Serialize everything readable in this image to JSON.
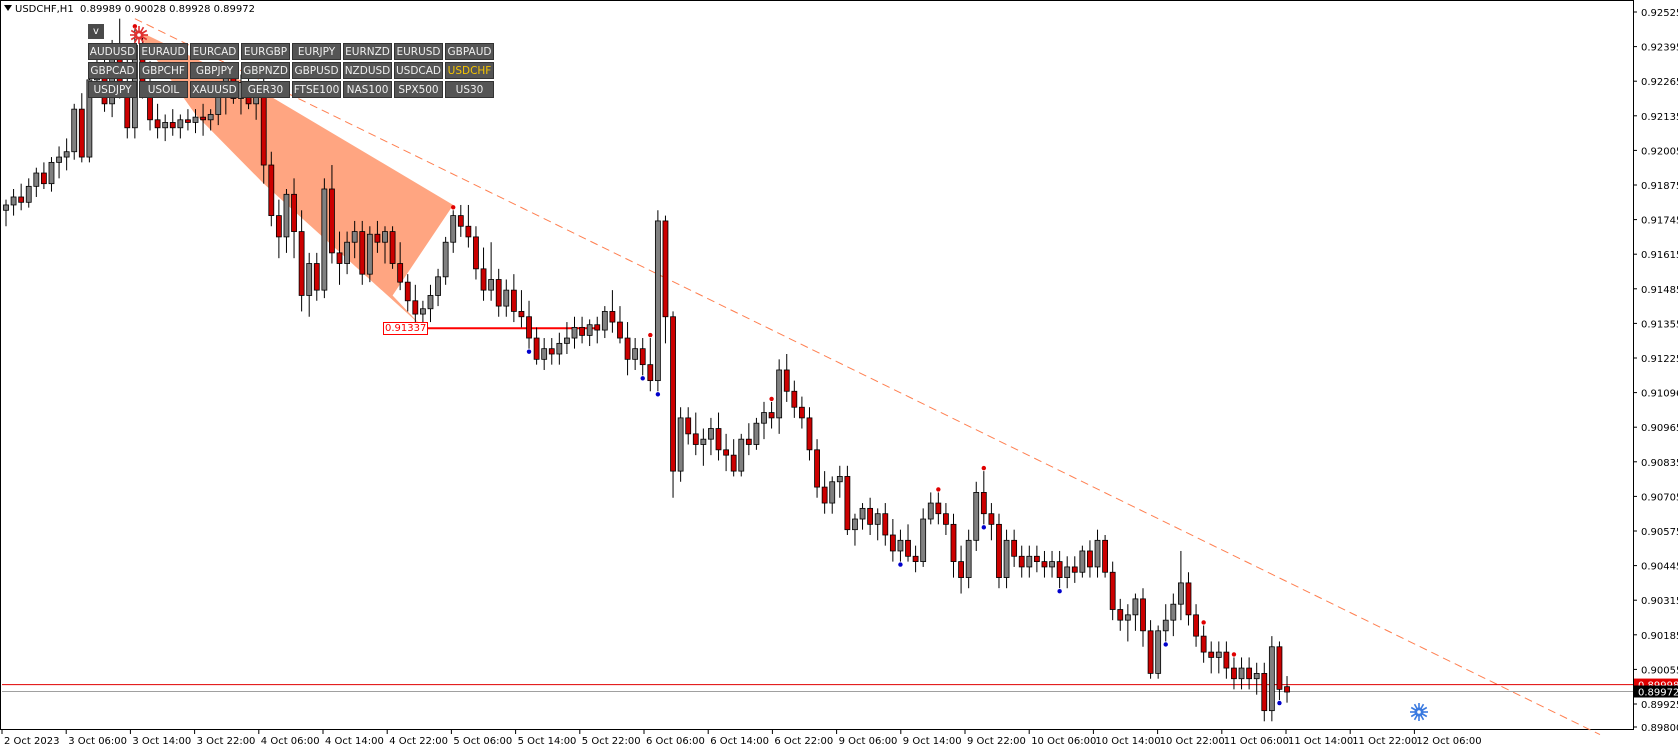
{
  "header": {
    "symbol_timeframe": "USDCHF,H1",
    "ohlc": "0.89989 0.90028 0.89928 0.89972"
  },
  "panel": {
    "toggle_label": "v",
    "active_symbol": "USDCHF",
    "symbols": [
      "AUDUSD",
      "EURAUD",
      "EURCAD",
      "EURGBP",
      "EURJPY",
      "EURNZD",
      "EURUSD",
      "GBPAUD",
      "GBPCAD",
      "GBPCHF",
      "GBPJPY",
      "GBPNZD",
      "GBPUSD",
      "NZDUSD",
      "USDCAD",
      "USDCHF",
      "USDJPY",
      "USOIL",
      "XAUUSD",
      "GER30",
      "FTSE100",
      "NAS100",
      "SPX500",
      "US30"
    ]
  },
  "colors": {
    "bull": "#808080",
    "bear": "#cc0000",
    "pattern_fill": "#ffa07a",
    "trendline": "#ff7f50",
    "swing_high_dot": "#e00000",
    "swing_low_dot": "#0000cc",
    "level_line": "#ff0000",
    "bid_line": "#a0a0a0"
  },
  "chart_data": {
    "type": "candlestick",
    "symbol": "USDCHF",
    "timeframe": "H1",
    "ylim": [
      0.898,
      0.9258
    ],
    "price_ticks": [
      "0.92525",
      "0.92395",
      "0.92265",
      "0.92135",
      "0.92005",
      "0.91875",
      "0.91745",
      "0.91615",
      "0.91485",
      "0.91355",
      "0.91225",
      "0.91096",
      "0.90965",
      "0.90835",
      "0.90705",
      "0.90575",
      "0.90445",
      "0.90315",
      "0.90185",
      "0.90055",
      "0.89925",
      "0.89800"
    ],
    "time_labels": [
      "2 Oct 2023",
      "3 Oct 06:00",
      "3 Oct 14:00",
      "3 Oct 22:00",
      "4 Oct 06:00",
      "4 Oct 14:00",
      "4 Oct 22:00",
      "5 Oct 06:00",
      "5 Oct 14:00",
      "5 Oct 22:00",
      "6 Oct 06:00",
      "6 Oct 14:00",
      "6 Oct 22:00",
      "9 Oct 06:00",
      "9 Oct 14:00",
      "9 Oct 22:00",
      "10 Oct 06:00",
      "10 Oct 14:00",
      "10 Oct 22:00",
      "11 Oct 06:00",
      "11 Oct 14:00",
      "11 Oct 22:00",
      "12 Oct 06:00"
    ],
    "level_label": "0.91337",
    "level_price": 0.91337,
    "bid_price": 0.89972,
    "bid_label": "0.89972",
    "red_line_price": 0.89998,
    "red_line_label": "0.89998",
    "candles": [
      [
        0.9178,
        0.9182,
        0.9172,
        0.918
      ],
      [
        0.918,
        0.9186,
        0.9176,
        0.9183
      ],
      [
        0.9183,
        0.9188,
        0.9178,
        0.9181
      ],
      [
        0.9181,
        0.919,
        0.9179,
        0.9187
      ],
      [
        0.9187,
        0.9194,
        0.9183,
        0.9192
      ],
      [
        0.9192,
        0.9196,
        0.9186,
        0.9188
      ],
      [
        0.9188,
        0.9198,
        0.9185,
        0.9196
      ],
      [
        0.9196,
        0.9202,
        0.919,
        0.9198
      ],
      [
        0.9198,
        0.9205,
        0.9193,
        0.92
      ],
      [
        0.92,
        0.9218,
        0.9197,
        0.9216
      ],
      [
        0.9216,
        0.9222,
        0.9196,
        0.9198
      ],
      [
        0.9198,
        0.923,
        0.9196,
        0.9227
      ],
      [
        0.9227,
        0.9236,
        0.9221,
        0.9233
      ],
      [
        0.9233,
        0.924,
        0.9215,
        0.9218
      ],
      [
        0.9218,
        0.9242,
        0.9213,
        0.9238
      ],
      [
        0.9238,
        0.925,
        0.922,
        0.9225
      ],
      [
        0.9225,
        0.9236,
        0.9205,
        0.9209
      ],
      [
        0.9209,
        0.9246,
        0.9205,
        0.924
      ],
      [
        0.924,
        0.9244,
        0.922,
        0.9224
      ],
      [
        0.9224,
        0.9234,
        0.9208,
        0.9212
      ],
      [
        0.9212,
        0.9218,
        0.9205,
        0.9209
      ],
      [
        0.9209,
        0.9214,
        0.9204,
        0.9211
      ],
      [
        0.9211,
        0.9216,
        0.9206,
        0.9209
      ],
      [
        0.9209,
        0.9214,
        0.9205,
        0.9212
      ],
      [
        0.9212,
        0.9216,
        0.9208,
        0.9211
      ],
      [
        0.9211,
        0.9216,
        0.9207,
        0.9213
      ],
      [
        0.9213,
        0.9218,
        0.9206,
        0.9212
      ],
      [
        0.9212,
        0.9216,
        0.9208,
        0.9214
      ],
      [
        0.9214,
        0.9226,
        0.921,
        0.9222
      ],
      [
        0.9222,
        0.923,
        0.9214,
        0.9228
      ],
      [
        0.9228,
        0.9232,
        0.9218,
        0.922
      ],
      [
        0.922,
        0.9229,
        0.9214,
        0.9226
      ],
      [
        0.9226,
        0.9228,
        0.9216,
        0.9218
      ],
      [
        0.9218,
        0.9226,
        0.9212,
        0.9224
      ],
      [
        0.9224,
        0.923,
        0.9188,
        0.9195
      ],
      [
        0.9195,
        0.92,
        0.9172,
        0.9176
      ],
      [
        0.9176,
        0.9182,
        0.916,
        0.9168
      ],
      [
        0.9168,
        0.9186,
        0.9162,
        0.9184
      ],
      [
        0.9184,
        0.919,
        0.916,
        0.917
      ],
      [
        0.917,
        0.9178,
        0.914,
        0.9146
      ],
      [
        0.9146,
        0.9162,
        0.9138,
        0.9158
      ],
      [
        0.9158,
        0.9162,
        0.9144,
        0.9148
      ],
      [
        0.9148,
        0.919,
        0.9145,
        0.9186
      ],
      [
        0.9186,
        0.9195,
        0.9158,
        0.9162
      ],
      [
        0.9162,
        0.917,
        0.915,
        0.9158
      ],
      [
        0.9158,
        0.917,
        0.9154,
        0.9166
      ],
      [
        0.9166,
        0.9174,
        0.916,
        0.917
      ],
      [
        0.917,
        0.9174,
        0.915,
        0.9154
      ],
      [
        0.9154,
        0.9172,
        0.9151,
        0.9169
      ],
      [
        0.9169,
        0.9174,
        0.9162,
        0.9166
      ],
      [
        0.9166,
        0.9172,
        0.9158,
        0.917
      ],
      [
        0.917,
        0.9172,
        0.9156,
        0.9158
      ],
      [
        0.9158,
        0.9166,
        0.9148,
        0.9151
      ],
      [
        0.9151,
        0.9154,
        0.914,
        0.9144
      ],
      [
        0.9144,
        0.915,
        0.9136,
        0.9139
      ],
      [
        0.9139,
        0.9144,
        0.9134,
        0.9141
      ],
      [
        0.9141,
        0.915,
        0.9136,
        0.9146
      ],
      [
        0.9146,
        0.9156,
        0.9142,
        0.9153
      ],
      [
        0.9153,
        0.9168,
        0.915,
        0.9166
      ],
      [
        0.9166,
        0.9178,
        0.9162,
        0.9176
      ],
      [
        0.9176,
        0.918,
        0.9168,
        0.9172
      ],
      [
        0.9172,
        0.918,
        0.9164,
        0.9168
      ],
      [
        0.9168,
        0.9172,
        0.9152,
        0.9156
      ],
      [
        0.9156,
        0.9164,
        0.9144,
        0.9148
      ],
      [
        0.9148,
        0.9166,
        0.9144,
        0.9152
      ],
      [
        0.9152,
        0.9156,
        0.9138,
        0.9142
      ],
      [
        0.9142,
        0.9152,
        0.9138,
        0.9148
      ],
      [
        0.9148,
        0.9154,
        0.9136,
        0.914
      ],
      [
        0.914,
        0.9148,
        0.9134,
        0.9138
      ],
      [
        0.9138,
        0.9144,
        0.9126,
        0.913
      ],
      [
        0.913,
        0.9134,
        0.912,
        0.9122
      ],
      [
        0.9122,
        0.913,
        0.9118,
        0.9126
      ],
      [
        0.9126,
        0.913,
        0.912,
        0.9124
      ],
      [
        0.9124,
        0.9132,
        0.912,
        0.9128
      ],
      [
        0.9128,
        0.9136,
        0.9124,
        0.913
      ],
      [
        0.913,
        0.9138,
        0.9126,
        0.9134
      ],
      [
        0.9134,
        0.9138,
        0.9128,
        0.9131
      ],
      [
        0.9131,
        0.9137,
        0.9127,
        0.9135
      ],
      [
        0.9135,
        0.9138,
        0.9128,
        0.9133
      ],
      [
        0.9133,
        0.9142,
        0.913,
        0.914
      ],
      [
        0.914,
        0.9148,
        0.9132,
        0.9136
      ],
      [
        0.9136,
        0.9142,
        0.9128,
        0.913
      ],
      [
        0.913,
        0.9136,
        0.9116,
        0.9122
      ],
      [
        0.9122,
        0.913,
        0.9118,
        0.9126
      ],
      [
        0.9126,
        0.913,
        0.9116,
        0.912
      ],
      [
        0.912,
        0.913,
        0.911,
        0.9114
      ],
      [
        0.9114,
        0.9178,
        0.911,
        0.9174
      ],
      [
        0.9174,
        0.9176,
        0.9128,
        0.9138
      ],
      [
        0.9138,
        0.914,
        0.907,
        0.908
      ],
      [
        0.908,
        0.9104,
        0.9076,
        0.91
      ],
      [
        0.91,
        0.9104,
        0.909,
        0.9094
      ],
      [
        0.9094,
        0.9102,
        0.9086,
        0.909
      ],
      [
        0.909,
        0.9096,
        0.9082,
        0.9092
      ],
      [
        0.9092,
        0.91,
        0.9086,
        0.9096
      ],
      [
        0.9096,
        0.9102,
        0.9084,
        0.9088
      ],
      [
        0.9088,
        0.9094,
        0.908,
        0.9086
      ],
      [
        0.9086,
        0.9092,
        0.9078,
        0.908
      ],
      [
        0.908,
        0.9094,
        0.9078,
        0.9092
      ],
      [
        0.9092,
        0.9098,
        0.9086,
        0.909
      ],
      [
        0.909,
        0.91,
        0.9088,
        0.9098
      ],
      [
        0.9098,
        0.9106,
        0.9092,
        0.9102
      ],
      [
        0.9102,
        0.9106,
        0.9096,
        0.91
      ],
      [
        0.91,
        0.9122,
        0.9094,
        0.9118
      ],
      [
        0.9118,
        0.9124,
        0.9106,
        0.911
      ],
      [
        0.911,
        0.9114,
        0.91,
        0.9104
      ],
      [
        0.9104,
        0.9108,
        0.9096,
        0.91
      ],
      [
        0.91,
        0.9104,
        0.9084,
        0.9088
      ],
      [
        0.9088,
        0.9092,
        0.907,
        0.9074
      ],
      [
        0.9074,
        0.908,
        0.9064,
        0.9068
      ],
      [
        0.9068,
        0.9078,
        0.9064,
        0.9076
      ],
      [
        0.9076,
        0.9082,
        0.907,
        0.9078
      ],
      [
        0.9078,
        0.9082,
        0.9056,
        0.9058
      ],
      [
        0.9058,
        0.9064,
        0.9052,
        0.9062
      ],
      [
        0.9062,
        0.9068,
        0.9058,
        0.9066
      ],
      [
        0.9066,
        0.907,
        0.9056,
        0.906
      ],
      [
        0.906,
        0.9066,
        0.9054,
        0.9064
      ],
      [
        0.9064,
        0.9068,
        0.9052,
        0.9056
      ],
      [
        0.9056,
        0.9062,
        0.9046,
        0.905
      ],
      [
        0.905,
        0.9058,
        0.9046,
        0.9054
      ],
      [
        0.9054,
        0.906,
        0.9046,
        0.9048
      ],
      [
        0.9048,
        0.9052,
        0.9042,
        0.9046
      ],
      [
        0.9046,
        0.9066,
        0.9044,
        0.9062
      ],
      [
        0.9062,
        0.9072,
        0.906,
        0.9068
      ],
      [
        0.9068,
        0.9072,
        0.906,
        0.9064
      ],
      [
        0.9064,
        0.9068,
        0.9056,
        0.906
      ],
      [
        0.906,
        0.9064,
        0.904,
        0.9046
      ],
      [
        0.9046,
        0.9052,
        0.9034,
        0.904
      ],
      [
        0.904,
        0.9058,
        0.9036,
        0.9054
      ],
      [
        0.9054,
        0.9076,
        0.905,
        0.9072
      ],
      [
        0.9072,
        0.908,
        0.906,
        0.9064
      ],
      [
        0.9064,
        0.9068,
        0.9054,
        0.906
      ],
      [
        0.906,
        0.9064,
        0.9036,
        0.904
      ],
      [
        0.904,
        0.9058,
        0.9036,
        0.9054
      ],
      [
        0.9054,
        0.9058,
        0.9044,
        0.9048
      ],
      [
        0.9048,
        0.9052,
        0.904,
        0.9044
      ],
      [
        0.9044,
        0.9052,
        0.904,
        0.9048
      ],
      [
        0.9048,
        0.9052,
        0.9042,
        0.9046
      ],
      [
        0.9046,
        0.905,
        0.904,
        0.9044
      ],
      [
        0.9044,
        0.905,
        0.904,
        0.9046
      ],
      [
        0.9046,
        0.905,
        0.9036,
        0.904
      ],
      [
        0.904,
        0.9048,
        0.9036,
        0.9044
      ],
      [
        0.9044,
        0.9048,
        0.9038,
        0.9042
      ],
      [
        0.9042,
        0.9052,
        0.904,
        0.905
      ],
      [
        0.905,
        0.9054,
        0.904,
        0.9044
      ],
      [
        0.9044,
        0.9058,
        0.904,
        0.9054
      ],
      [
        0.9054,
        0.9056,
        0.904,
        0.9042
      ],
      [
        0.9042,
        0.9046,
        0.9024,
        0.9028
      ],
      [
        0.9028,
        0.9032,
        0.902,
        0.9024
      ],
      [
        0.9024,
        0.903,
        0.9016,
        0.9026
      ],
      [
        0.9026,
        0.9034,
        0.902,
        0.9032
      ],
      [
        0.9032,
        0.9036,
        0.9014,
        0.902
      ],
      [
        0.902,
        0.9024,
        0.9002,
        0.9004
      ],
      [
        0.9004,
        0.9022,
        0.9002,
        0.902
      ],
      [
        0.902,
        0.903,
        0.9016,
        0.9024
      ],
      [
        0.9024,
        0.9034,
        0.9018,
        0.903
      ],
      [
        0.903,
        0.905,
        0.9024,
        0.9038
      ],
      [
        0.9038,
        0.9042,
        0.9022,
        0.9026
      ],
      [
        0.9026,
        0.903,
        0.9014,
        0.9018
      ],
      [
        0.9018,
        0.9022,
        0.9008,
        0.9012
      ],
      [
        0.9012,
        0.9016,
        0.9004,
        0.901
      ],
      [
        0.901,
        0.9016,
        0.9004,
        0.9012
      ],
      [
        0.9012,
        0.9016,
        0.9002,
        0.9006
      ],
      [
        0.9006,
        0.901,
        0.8998,
        0.9002
      ],
      [
        0.9002,
        0.901,
        0.8998,
        0.9006
      ],
      [
        0.9006,
        0.901,
        0.8998,
        0.9002
      ],
      [
        0.9002,
        0.9008,
        0.8996,
        0.9004
      ],
      [
        0.9004,
        0.9008,
        0.8986,
        0.899
      ],
      [
        0.899,
        0.9018,
        0.8986,
        0.9014
      ],
      [
        0.9014,
        0.9016,
        0.8994,
        0.8998
      ],
      [
        0.8999,
        0.9003,
        0.8993,
        0.8997
      ]
    ],
    "swing_highs": [
      17,
      59,
      85,
      101,
      123,
      129,
      158,
      162,
      171
    ],
    "swing_lows": [
      69,
      84,
      86,
      118,
      129,
      139,
      153,
      168
    ]
  }
}
